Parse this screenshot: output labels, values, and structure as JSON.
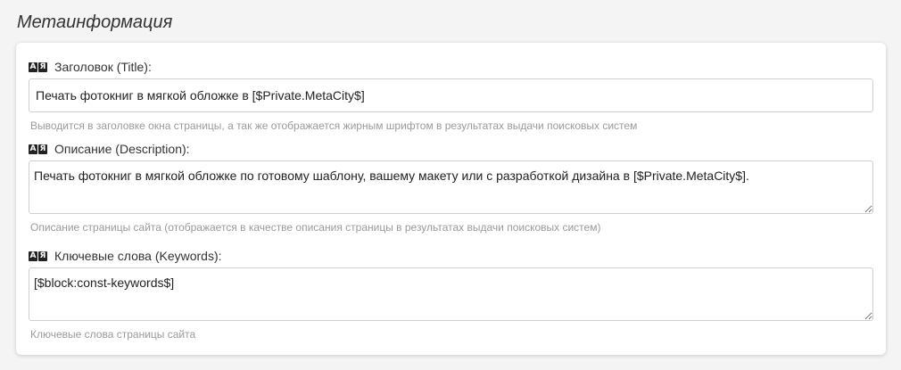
{
  "section": {
    "title": "Метаинформация"
  },
  "fields": {
    "title": {
      "label": "Заголовок (Title):",
      "value": "Печать фотокниг в мягкой обложке в [$Private.MetaCity$]",
      "hint": "Выводится в заголовке окна страницы, а так же отображается жирным шрифтом в результатах выдачи поисковых систем",
      "icon": "language-icon"
    },
    "description": {
      "label": "Описание (Description):",
      "value": "Печать фотокниг в мягкой обложке по готовому шаблону, вашему макету или с разработкой дизайна в [$Private.MetaCity$].",
      "hint": "Описание страницы сайта (отображается в качестве описания страницы в результатах выдачи поисковых систем)",
      "icon": "language-icon"
    },
    "keywords": {
      "label": "Ключевые слова (Keywords):",
      "value": "[$block:const-keywords$]",
      "hint": "Ключевые слова страницы сайта",
      "icon": "language-icon"
    }
  },
  "icon_glyphs": {
    "latin": "A",
    "cyrillic": "Я"
  }
}
